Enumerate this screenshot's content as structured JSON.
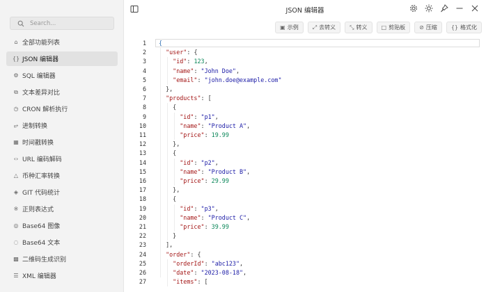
{
  "app": {
    "title": "JSON 编辑器"
  },
  "search": {
    "placeholder": "Search..."
  },
  "sidebar": {
    "items": [
      {
        "label": "全部功能列表",
        "icon": "home-icon",
        "glyph": "⌂",
        "active": false
      },
      {
        "label": "JSON 编辑器",
        "icon": "braces-icon",
        "glyph": "{}",
        "active": true
      },
      {
        "label": "SQL 编辑器",
        "icon": "gear-icon",
        "glyph": "⚙",
        "active": false
      },
      {
        "label": "文本差异对比",
        "icon": "copy-icon",
        "glyph": "⧉",
        "active": false
      },
      {
        "label": "CRON 解析执行",
        "icon": "clock-icon",
        "glyph": "◷",
        "active": false
      },
      {
        "label": "进制转换",
        "icon": "binary-icon",
        "glyph": "⥂",
        "active": false
      },
      {
        "label": "时间戳转换",
        "icon": "calendar-icon",
        "glyph": "▦",
        "active": false
      },
      {
        "label": "URL 编码解码",
        "icon": "code-icon",
        "glyph": "‹›",
        "active": false
      },
      {
        "label": "币种汇率转换",
        "icon": "currency-icon",
        "glyph": "△",
        "active": false
      },
      {
        "label": "GIT 代码统计",
        "icon": "git-icon",
        "glyph": "◈",
        "active": false
      },
      {
        "label": "正则表达式",
        "icon": "regex-icon",
        "glyph": "※",
        "active": false
      },
      {
        "label": "Base64 图像",
        "icon": "image-icon",
        "glyph": "◎",
        "active": false
      },
      {
        "label": "Base64 文本",
        "icon": "text-icon",
        "glyph": "◌",
        "active": false
      },
      {
        "label": "二维码生成识别",
        "icon": "qrcode-icon",
        "glyph": "▩",
        "active": false
      },
      {
        "label": "XML 编辑器",
        "icon": "list-icon",
        "glyph": "☰",
        "active": false
      }
    ]
  },
  "toolbar": {
    "buttons": [
      {
        "label": "示例",
        "icon": "example-icon",
        "glyph": "▣"
      },
      {
        "label": "去转义",
        "icon": "unescape-icon",
        "glyph": "⤢"
      },
      {
        "label": "转义",
        "icon": "escape-icon",
        "glyph": "⤡"
      },
      {
        "label": "剪贴板",
        "icon": "clipboard-icon",
        "glyph": "□"
      },
      {
        "label": "压缩",
        "icon": "compress-icon",
        "glyph": "⊘"
      },
      {
        "label": "格式化",
        "icon": "format-icon",
        "glyph": "{}"
      }
    ]
  },
  "editor": {
    "lines": [
      [
        [
          "brace",
          "{"
        ]
      ],
      [
        [
          "sp",
          "  "
        ],
        [
          "key",
          "\"user\""
        ],
        [
          "pun",
          ": {"
        ]
      ],
      [
        [
          "sp",
          "    "
        ],
        [
          "key",
          "\"id\""
        ],
        [
          "pun",
          ": "
        ],
        [
          "num",
          "123"
        ],
        [
          "pun",
          ","
        ]
      ],
      [
        [
          "sp",
          "    "
        ],
        [
          "key",
          "\"name\""
        ],
        [
          "pun",
          ": "
        ],
        [
          "str",
          "\"John Doe\""
        ],
        [
          "pun",
          ","
        ]
      ],
      [
        [
          "sp",
          "    "
        ],
        [
          "key",
          "\"email\""
        ],
        [
          "pun",
          ": "
        ],
        [
          "str",
          "\"john.doe@example.com\""
        ]
      ],
      [
        [
          "sp",
          "  "
        ],
        [
          "pun",
          "},"
        ]
      ],
      [
        [
          "sp",
          "  "
        ],
        [
          "key",
          "\"products\""
        ],
        [
          "pun",
          ": ["
        ]
      ],
      [
        [
          "sp",
          "    "
        ],
        [
          "pun",
          "{"
        ]
      ],
      [
        [
          "sp",
          "      "
        ],
        [
          "key",
          "\"id\""
        ],
        [
          "pun",
          ": "
        ],
        [
          "str",
          "\"p1\""
        ],
        [
          "pun",
          ","
        ]
      ],
      [
        [
          "sp",
          "      "
        ],
        [
          "key",
          "\"name\""
        ],
        [
          "pun",
          ": "
        ],
        [
          "str",
          "\"Product A\""
        ],
        [
          "pun",
          ","
        ]
      ],
      [
        [
          "sp",
          "      "
        ],
        [
          "key",
          "\"price\""
        ],
        [
          "pun",
          ": "
        ],
        [
          "num",
          "19.99"
        ]
      ],
      [
        [
          "sp",
          "    "
        ],
        [
          "pun",
          "},"
        ]
      ],
      [
        [
          "sp",
          "    "
        ],
        [
          "pun",
          "{"
        ]
      ],
      [
        [
          "sp",
          "      "
        ],
        [
          "key",
          "\"id\""
        ],
        [
          "pun",
          ": "
        ],
        [
          "str",
          "\"p2\""
        ],
        [
          "pun",
          ","
        ]
      ],
      [
        [
          "sp",
          "      "
        ],
        [
          "key",
          "\"name\""
        ],
        [
          "pun",
          ": "
        ],
        [
          "str",
          "\"Product B\""
        ],
        [
          "pun",
          ","
        ]
      ],
      [
        [
          "sp",
          "      "
        ],
        [
          "key",
          "\"price\""
        ],
        [
          "pun",
          ": "
        ],
        [
          "num",
          "29.99"
        ]
      ],
      [
        [
          "sp",
          "    "
        ],
        [
          "pun",
          "},"
        ]
      ],
      [
        [
          "sp",
          "    "
        ],
        [
          "pun",
          "{"
        ]
      ],
      [
        [
          "sp",
          "      "
        ],
        [
          "key",
          "\"id\""
        ],
        [
          "pun",
          ": "
        ],
        [
          "str",
          "\"p3\""
        ],
        [
          "pun",
          ","
        ]
      ],
      [
        [
          "sp",
          "      "
        ],
        [
          "key",
          "\"name\""
        ],
        [
          "pun",
          ": "
        ],
        [
          "str",
          "\"Product C\""
        ],
        [
          "pun",
          ","
        ]
      ],
      [
        [
          "sp",
          "      "
        ],
        [
          "key",
          "\"price\""
        ],
        [
          "pun",
          ": "
        ],
        [
          "num",
          "39.99"
        ]
      ],
      [
        [
          "sp",
          "    "
        ],
        [
          "pun",
          "}"
        ]
      ],
      [
        [
          "sp",
          "  "
        ],
        [
          "pun",
          "],"
        ]
      ],
      [
        [
          "sp",
          "  "
        ],
        [
          "key",
          "\"order\""
        ],
        [
          "pun",
          ": {"
        ]
      ],
      [
        [
          "sp",
          "    "
        ],
        [
          "key",
          "\"orderId\""
        ],
        [
          "pun",
          ": "
        ],
        [
          "str",
          "\"abc123\""
        ],
        [
          "pun",
          ","
        ]
      ],
      [
        [
          "sp",
          "    "
        ],
        [
          "key",
          "\"date\""
        ],
        [
          "pun",
          ": "
        ],
        [
          "str",
          "\"2023-08-18\""
        ],
        [
          "pun",
          ","
        ]
      ],
      [
        [
          "sp",
          "    "
        ],
        [
          "key",
          "\"items\""
        ],
        [
          "pun",
          ": ["
        ]
      ]
    ]
  }
}
